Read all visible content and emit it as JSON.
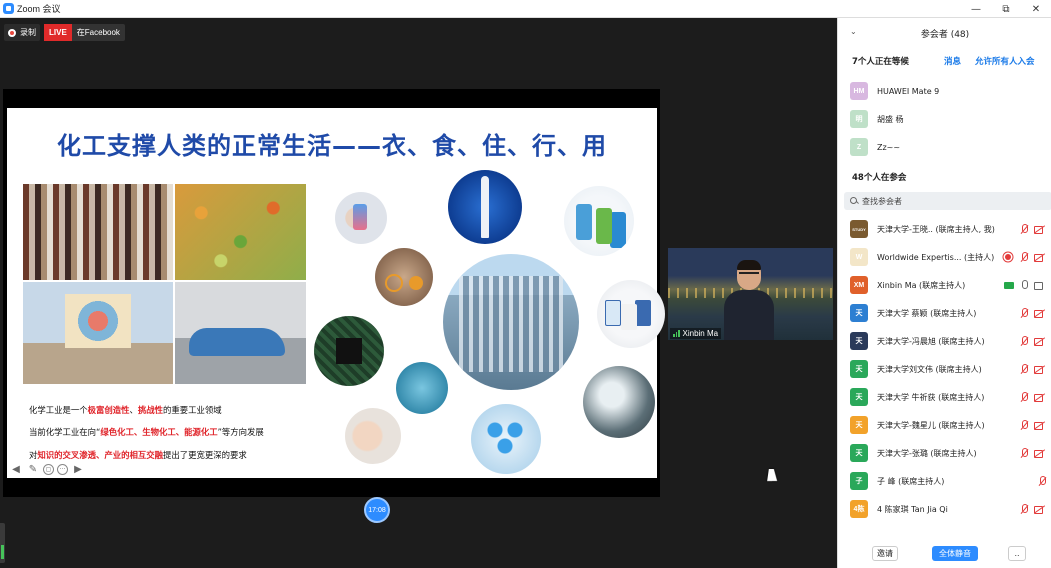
{
  "window": {
    "title": "Zoom 会议",
    "controls": [
      "—",
      "⧉",
      "✕"
    ]
  },
  "stage": {
    "recording_label": "录制",
    "live_tag": "LIVE",
    "live_target": "在Facebook",
    "time_badge": "17:08"
  },
  "slide": {
    "title": "化工支撑人类的正常生活——衣、食、住、行、用",
    "line1": {
      "pre": "化学工业是一个",
      "red1": "极富创造性",
      "mid": "、",
      "red2": "挑战性",
      "post": "的重要工业领域"
    },
    "line2": {
      "pre": "当前化学工业在向“",
      "red": "绿色化工、生物化工、能源化工",
      "post": "”等方向发展"
    },
    "line3": {
      "pre": "对",
      "red": "知识的交叉渗透、产业的相互交融",
      "post": "提出了更宽更深的要求"
    },
    "toolbar": [
      "◀",
      "✎",
      "▢",
      "···",
      "▶"
    ]
  },
  "speaker": {
    "name": "Xinbin Ma"
  },
  "panel": {
    "header": "参会者 (48)",
    "collapse_icon": "⌄",
    "waiting": {
      "title": "7个人正在等候",
      "message_link": "消息",
      "admit_all_link": "允许所有人入会",
      "people": [
        {
          "initials": "HM",
          "color": "#d8b8e0",
          "name": "HUAWEI Mate 9"
        },
        {
          "initials": "明",
          "color": "#bfe0c8",
          "name": "胡盛 杨"
        },
        {
          "initials": "Z",
          "color": "#bfe0c8",
          "name": "Zz~~"
        }
      ]
    },
    "in_meeting": {
      "title": "48个人在参会",
      "search_placeholder": "查找参会者",
      "people": [
        {
          "initials": "STUDY",
          "color": "#7a5a30",
          "name": "天津大学-王晓.. (联席主持人, 我)",
          "icons": [
            "mic-off",
            "cam-off"
          ]
        },
        {
          "initials": "W",
          "color": "#f3e6c8",
          "name": "Worldwide Expertis... (主持人)",
          "icons": [
            "rec",
            "mic-off",
            "cam-off"
          ]
        },
        {
          "initials": "XM",
          "color": "#e0602a",
          "name": "Xinbin Ma (联席主持人)",
          "icons": [
            "share",
            "mic-on",
            "cam-on"
          ]
        },
        {
          "initials": "天",
          "color": "#2d7fd2",
          "name": "天津大学 蔡颖 (联席主持人)",
          "icons": [
            "mic-off",
            "cam-off"
          ]
        },
        {
          "initials": "天",
          "color": "#2a3a5a",
          "name": "天津大学-冯晨旭 (联席主持人)",
          "icons": [
            "mic-off",
            "cam-off"
          ]
        },
        {
          "initials": "天",
          "color": "#2aa85a",
          "name": "天津大学刘文伟 (联席主持人)",
          "icons": [
            "mic-off",
            "cam-off"
          ]
        },
        {
          "initials": "天",
          "color": "#2aa85a",
          "name": "天津大学 牛祈获 (联席主持人)",
          "icons": [
            "mic-off",
            "cam-off"
          ]
        },
        {
          "initials": "天",
          "color": "#f2a22a",
          "name": "天津大学-魏星儿 (联席主持人)",
          "icons": [
            "mic-off",
            "cam-off"
          ]
        },
        {
          "initials": "天",
          "color": "#2aa85a",
          "name": "天津大学-张璐 (联席主持人)",
          "icons": [
            "mic-off",
            "cam-off"
          ]
        },
        {
          "initials": "子",
          "color": "#2aa85a",
          "name": "子 峰 (联席主持人)",
          "icons": [
            "mic-off"
          ]
        },
        {
          "initials": "4陈",
          "color": "#f2a22a",
          "name": "4 陈家琪 Tan Jia Qi",
          "icons": [
            "mic-off",
            "cam-off"
          ]
        }
      ]
    },
    "footer": {
      "invite": "邀请",
      "mute_all": "全体静音",
      "more": ".."
    }
  }
}
